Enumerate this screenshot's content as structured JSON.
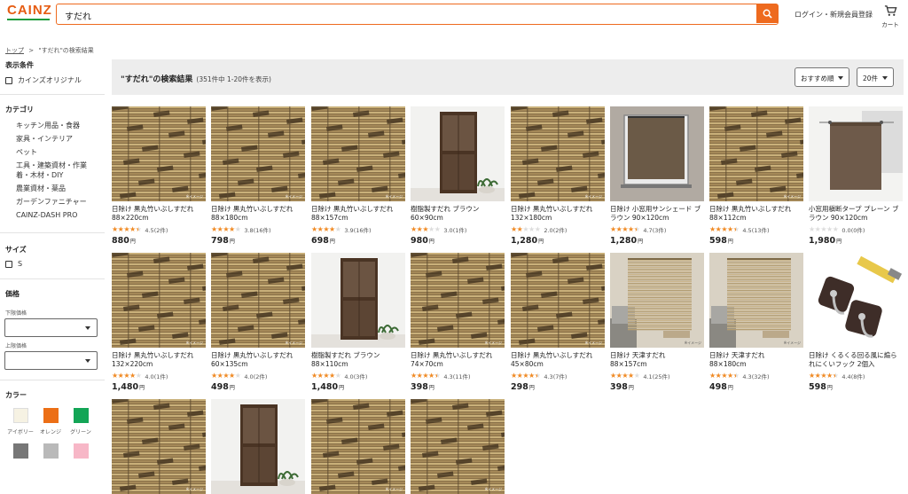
{
  "header": {
    "logo": "CAINZ",
    "search_value": "すだれ",
    "login_label": "ログイン・新規会員登録",
    "cart_label": "カート"
  },
  "breadcrumb": {
    "top": "トップ",
    "sep": ">",
    "current": "\"すだれ\"の検索結果"
  },
  "sidebar": {
    "display_heading": "表示条件",
    "cainz_original": "カインズオリジナル",
    "category_heading": "カテゴリ",
    "categories": [
      "キッチン用品・食器",
      "家具・インテリア",
      "ペット",
      "工具・建築資材・作業",
      "着・木材・DIY",
      "農業資材・薬品",
      "ガーデンファニチャー",
      "CAINZ-DASH PRO"
    ],
    "size_heading": "サイズ",
    "size_option": "S",
    "price_heading": "価格",
    "price_min_label": "下限価格",
    "price_max_label": "上限価格",
    "color_heading": "カラー",
    "colors": [
      {
        "name": "アイボリー",
        "hex": "#f6f2e3"
      },
      {
        "name": "オレンジ",
        "hex": "#ec6f16"
      },
      {
        "name": "グリーン",
        "hex": "#13a556"
      },
      {
        "name": "",
        "hex": "#777777"
      },
      {
        "name": "",
        "hex": "#b9b9b9"
      },
      {
        "name": "",
        "hex": "#f7b7c7"
      }
    ]
  },
  "results": {
    "title": "\"すだれ\"の検索結果",
    "count": "(351件中 1-20件を表示)",
    "sort_label": "おすすめ順",
    "per_page_label": "20件"
  },
  "products": [
    {
      "name": "日除け 黒丸竹いぶしすだれ 88×220cm",
      "rating": 4.5,
      "reviews": "4.5(2件)",
      "price": "880",
      "img": "bamboo"
    },
    {
      "name": "日除け 黒丸竹いぶしすだれ 88×180cm",
      "rating": 3.8,
      "reviews": "3.8(16件)",
      "price": "798",
      "img": "bamboo"
    },
    {
      "name": "日除け 黒丸竹いぶしすだれ 88×157cm",
      "rating": 3.9,
      "reviews": "3.9(16件)",
      "price": "698",
      "img": "bamboo"
    },
    {
      "name": "樹脂製すだれ ブラウン 60×90cm",
      "rating": 3.0,
      "reviews": "3.0(1件)",
      "price": "980",
      "img": "door"
    },
    {
      "name": "日除け 黒丸竹いぶしすだれ 132×180cm",
      "rating": 2.0,
      "reviews": "2.0(2件)",
      "price": "1,280",
      "img": "bamboo"
    },
    {
      "name": "日除け 小窓用サンシェード ブラウン 90×120cm",
      "rating": 4.7,
      "reviews": "4.7(3件)",
      "price": "1,280",
      "img": "window"
    },
    {
      "name": "日除け 黒丸竹いぶしすだれ 88×112cm",
      "rating": 4.5,
      "reviews": "4.5(13件)",
      "price": "598",
      "img": "bamboo"
    },
    {
      "name": "小窓用槇断タープ プレーン ブラウン 90×120cm",
      "rating": 0.0,
      "reviews": "0.0(0件)",
      "price": "1,980",
      "img": "tarp"
    },
    {
      "name": "日除け 黒丸竹いぶしすだれ 132×220cm",
      "rating": 4.0,
      "reviews": "4.0(1件)",
      "price": "1,480",
      "img": "bamboo"
    },
    {
      "name": "日除け 黒丸竹いぶしすだれ 60×135cm",
      "rating": 4.0,
      "reviews": "4.0(2件)",
      "price": "498",
      "img": "bamboo"
    },
    {
      "name": "樹脂製すだれ ブラウン 88×110cm",
      "rating": 4.0,
      "reviews": "4.0(3件)",
      "price": "1,480",
      "img": "door"
    },
    {
      "name": "日除け 黒丸竹いぶしすだれ 74×70cm",
      "rating": 4.3,
      "reviews": "4.3(11件)",
      "price": "398",
      "img": "bamboo"
    },
    {
      "name": "日除け 黒丸竹いぶしすだれ 45×80cm",
      "rating": 4.3,
      "reviews": "4.3(7件)",
      "price": "298",
      "img": "bamboo"
    },
    {
      "name": "日除け 天津すだれ 88×157cm",
      "rating": 4.1,
      "reviews": "4.1(25件)",
      "price": "398",
      "img": "reed"
    },
    {
      "name": "日除け 天津すだれ 88×180cm",
      "rating": 4.3,
      "reviews": "4.3(32件)",
      "price": "498",
      "img": "reed"
    },
    {
      "name": "日除け くるくる回る風に煽られにくいフック 2個入",
      "rating": 4.4,
      "reviews": "4.4(8件)",
      "price": "598",
      "img": "hook"
    },
    {
      "name": "",
      "rating": 0,
      "reviews": "",
      "price": "",
      "img": "bamboo"
    },
    {
      "name": "",
      "rating": 0,
      "reviews": "",
      "price": "",
      "img": "door"
    },
    {
      "name": "",
      "rating": 0,
      "reviews": "",
      "price": "",
      "img": "bamboo"
    },
    {
      "name": "",
      "rating": 0,
      "reviews": "",
      "price": "",
      "img": "bamboo"
    }
  ],
  "price_unit": "円",
  "image_caption": "※イメージ",
  "colors": {
    "accent": "#ee6a1e",
    "star": "#f08a24",
    "star_empty": "#dddddd",
    "logo_line": "#1d9b3d"
  }
}
